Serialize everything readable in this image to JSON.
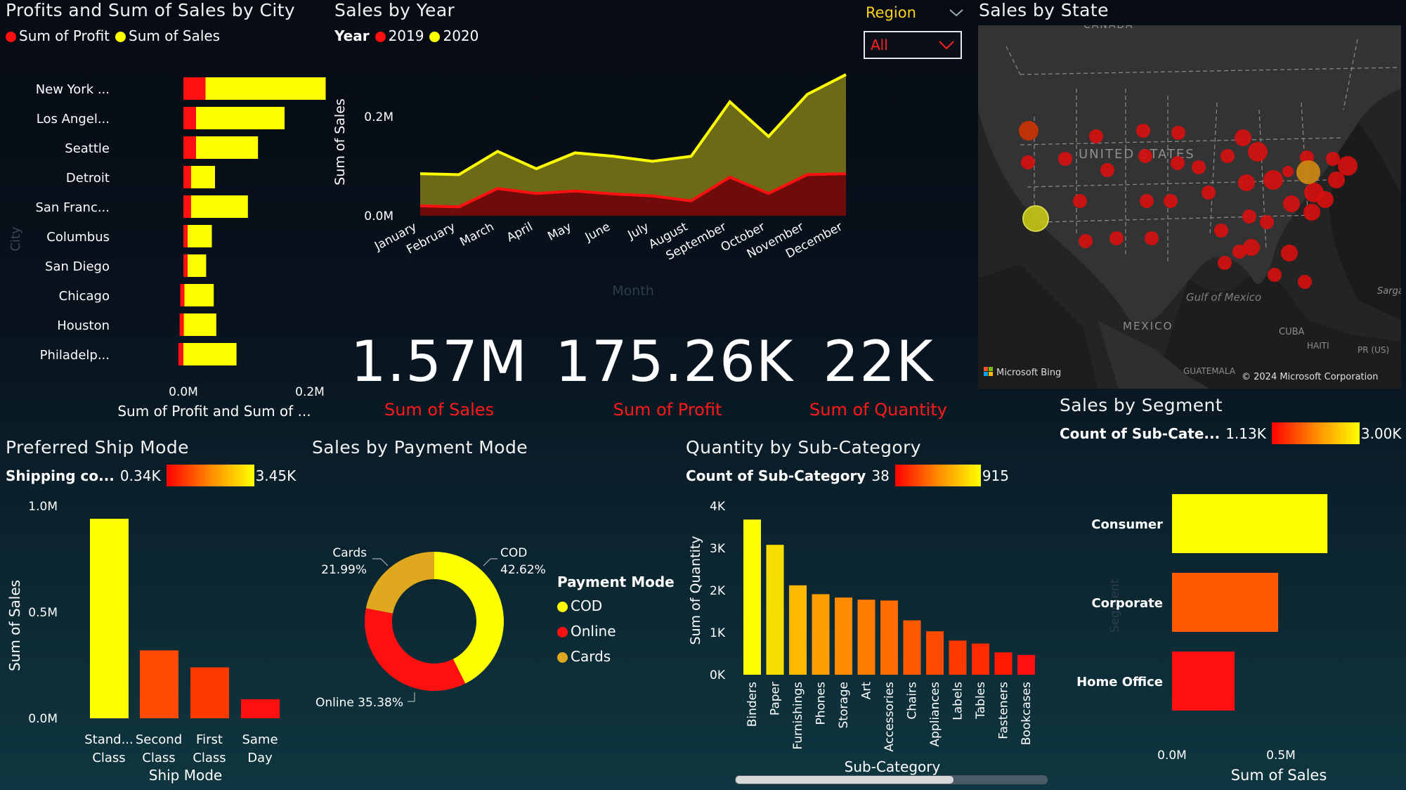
{
  "colors": {
    "yellow": "#ffff00",
    "red": "#ff0000",
    "orange": "#ff5a00",
    "gold": "#e0a81e",
    "bg": "#08121d"
  },
  "city_panel": {
    "title": "Profits and Sum of Sales by City",
    "legend_profit": "Sum of Profit",
    "legend_sales": "Sum of Sales",
    "y_axis_label": "City",
    "x_axis_label": "Sum of Profit and Sum of ...",
    "x_ticks": [
      "0.0M",
      "0.2M"
    ]
  },
  "year_panel": {
    "title": "Sales by Year",
    "legend_title": "Year",
    "legend_2019": "2019",
    "legend_2020": "2020",
    "y_axis_label": "Sum of Sales",
    "x_axis_label": "Month",
    "y_ticks": [
      "0.0M",
      "0.2M"
    ]
  },
  "region_filter": {
    "label": "Region",
    "selected": "All"
  },
  "state_panel": {
    "title": "Sales by State",
    "map_labels": [
      "CANADA",
      "UNITED STATES",
      "MEXICO",
      "Gulf of Mexico",
      "CUBA",
      "HAITI",
      "PR (US)",
      "GUATEMALA",
      "Sarga"
    ],
    "attribution_left": "Microsoft Bing",
    "attribution_right": "© 2024 Microsoft Corporation"
  },
  "kpis": [
    {
      "value": "1.57M",
      "label": "Sum of Sales"
    },
    {
      "value": "175.26K",
      "label": "Sum of Profit"
    },
    {
      "value": "22K",
      "label": "Sum of Quantity"
    }
  ],
  "ship_panel": {
    "title": "Preferred Ship Mode",
    "legend_title": "Shipping co...",
    "legend_min": "0.34K",
    "legend_max": "3.45K",
    "y_axis_label": "Sum of Sales",
    "x_axis_label": "Ship Mode",
    "y_ticks": [
      "1.0M",
      "0.5M",
      "0.0M"
    ]
  },
  "payment_panel": {
    "title": "Sales by Payment Mode",
    "legend_title": "Payment Mode",
    "legend_items": [
      "COD",
      "Online",
      "Cards"
    ],
    "label_cod_name": "COD",
    "label_cod_pct": "42.62%",
    "label_cards_name": "Cards",
    "label_cards_pct": "21.99%",
    "label_online": "Online 35.38%"
  },
  "subcat_panel": {
    "title": "Quantity by Sub-Category",
    "legend_title": "Count of Sub-Category",
    "legend_min": "38",
    "legend_max": "915",
    "y_axis_label": "Sum of Quantity",
    "x_axis_label": "Sub-Category",
    "y_ticks": [
      "4K",
      "3K",
      "2K",
      "1K",
      "0K"
    ]
  },
  "segment_panel": {
    "title": "Sales by Segment",
    "legend_title": "Count of Sub-Cate...",
    "legend_min": "1.13K",
    "legend_max": "3.00K",
    "y_axis_label": "Segment",
    "x_axis_label": "Sum of Sales",
    "x_ticks": [
      "0.0M",
      "0.5M"
    ]
  },
  "chart_data": [
    {
      "type": "bar",
      "orientation": "horizontal",
      "categories": [
        "New York ...",
        "Los Angel...",
        "Seattle",
        "Detroit",
        "San Franc...",
        "Columbus",
        "San Diego",
        "Chicago",
        "Houston",
        "Philadelp..."
      ],
      "series": [
        {
          "name": "Sum of Profit",
          "values": [
            0.035,
            0.02,
            0.02,
            0.012,
            0.012,
            0.005,
            0.003,
            -0.005,
            -0.006,
            -0.008
          ]
        },
        {
          "name": "Sum of Sales",
          "values": [
            0.19,
            0.14,
            0.098,
            0.038,
            0.09,
            0.04,
            0.033,
            0.048,
            0.052,
            0.084
          ]
        }
      ],
      "xlim": [
        -0.01,
        0.2
      ]
    },
    {
      "type": "area",
      "categories": [
        "January",
        "February",
        "March",
        "April",
        "May",
        "June",
        "July",
        "August",
        "September",
        "October",
        "November",
        "December"
      ],
      "series": [
        {
          "name": "2020",
          "values": [
            0.085,
            0.083,
            0.13,
            0.095,
            0.127,
            0.12,
            0.11,
            0.12,
            0.23,
            0.16,
            0.245,
            0.285
          ]
        },
        {
          "name": "2019",
          "values": [
            0.02,
            0.018,
            0.055,
            0.045,
            0.05,
            0.044,
            0.04,
            0.03,
            0.078,
            0.045,
            0.083,
            0.085
          ]
        }
      ],
      "ylim": [
        0,
        0.3
      ]
    },
    {
      "type": "bar",
      "categories": [
        "Stand... Class",
        "Second Class",
        "First Class",
        "Same Day"
      ],
      "values": [
        0.94,
        0.32,
        0.24,
        0.09
      ],
      "ylim": [
        0,
        1.0
      ]
    },
    {
      "type": "pie",
      "categories": [
        "COD",
        "Online",
        "Cards"
      ],
      "values": [
        42.62,
        35.38,
        21.99
      ]
    },
    {
      "type": "bar",
      "categories": [
        "Binders",
        "Paper",
        "Furnishings",
        "Phones",
        "Storage",
        "Art",
        "Accessories",
        "Chairs",
        "Appliances",
        "Labels",
        "Tables",
        "Fasteners",
        "Bookcases"
      ],
      "values": [
        3680,
        3080,
        2120,
        1910,
        1830,
        1780,
        1760,
        1290,
        1030,
        810,
        740,
        530,
        470
      ],
      "ylim": [
        0,
        4000
      ]
    },
    {
      "type": "bar",
      "orientation": "horizontal",
      "categories": [
        "Consumer",
        "Corporate",
        "Home Office"
      ],
      "values": [
        0.82,
        0.56,
        0.33
      ],
      "xlim": [
        0,
        0.8
      ]
    }
  ]
}
